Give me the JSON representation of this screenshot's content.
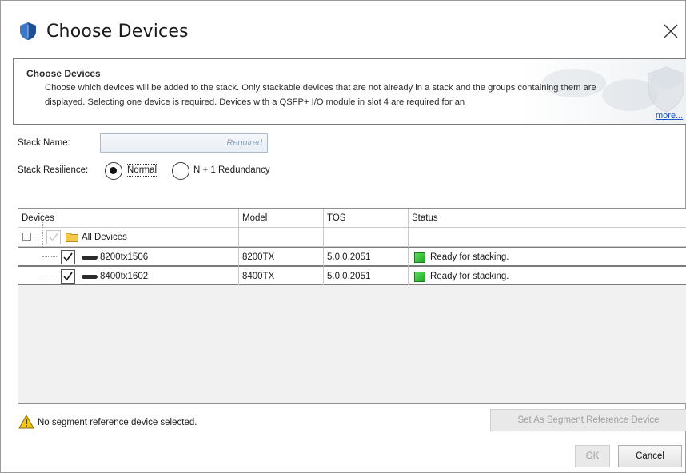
{
  "window": {
    "title": "Choose Devices",
    "icon": "shield-icon",
    "close_icon": "close-icon"
  },
  "banner": {
    "title": "Choose Devices",
    "description": "Choose which devices will be added to the stack. Only stackable devices that are not already in a stack and the groups containing them are displayed. Selecting one device is required. Devices with a QSFP+ I/O module in slot 4 are required for an",
    "more_link": "more..."
  },
  "form": {
    "stack_name_label": "Stack Name:",
    "stack_name_value": "",
    "stack_name_placeholder": "Required",
    "resilience_label": "Stack Resilience:",
    "resilience_options": [
      {
        "label": "Normal",
        "selected": true
      },
      {
        "label": "N + 1 Redundancy",
        "selected": false
      }
    ]
  },
  "table": {
    "columns": [
      "Devices",
      "Model",
      "TOS",
      "Status"
    ],
    "group": {
      "label": "All Devices",
      "expanded": true,
      "checked": true,
      "enabled": false
    },
    "rows": [
      {
        "device": "8200tx1506",
        "model": "8200TX",
        "tos": "5.0.0.2051",
        "status": "Ready for stacking.",
        "checked": true
      },
      {
        "device": "8400tx1602",
        "model": "8400TX",
        "tos": "5.0.0.2051",
        "status": "Ready for stacking.",
        "checked": true
      }
    ]
  },
  "footer": {
    "warning_icon": "warning-icon",
    "warning_text": "No segment reference device selected.",
    "segment_button": "Set As Segment Reference Device",
    "ok_button": "OK",
    "cancel_button": "Cancel"
  },
  "colors": {
    "status_ready": "#2fb52f",
    "link": "#1a55c8",
    "folder": "#f2c84b"
  }
}
